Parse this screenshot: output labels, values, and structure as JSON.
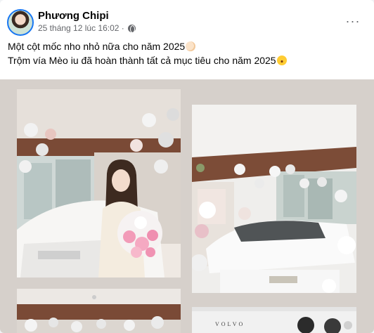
{
  "post": {
    "author_name": "Phương Chipi",
    "timestamp": "25 tháng 12 lúc 16:02 ·",
    "privacy_icon": "globe-icon",
    "more_icon": "more-horizontal-icon",
    "more_label": "···",
    "caption_line_1": "Một cột mốc nho nhỏ nữa cho năm 2025",
    "caption_line_2": "Trộm vía Mèo iu đã hoàn thành tất cả mục tiêu cho năm 2025"
  },
  "photos": {
    "photo_4_brand": "VOLVO"
  },
  "colors": {
    "accent": "#1877f2",
    "text_primary": "#050505",
    "text_secondary": "#65676b",
    "grid_background": "#d6d0cb"
  }
}
